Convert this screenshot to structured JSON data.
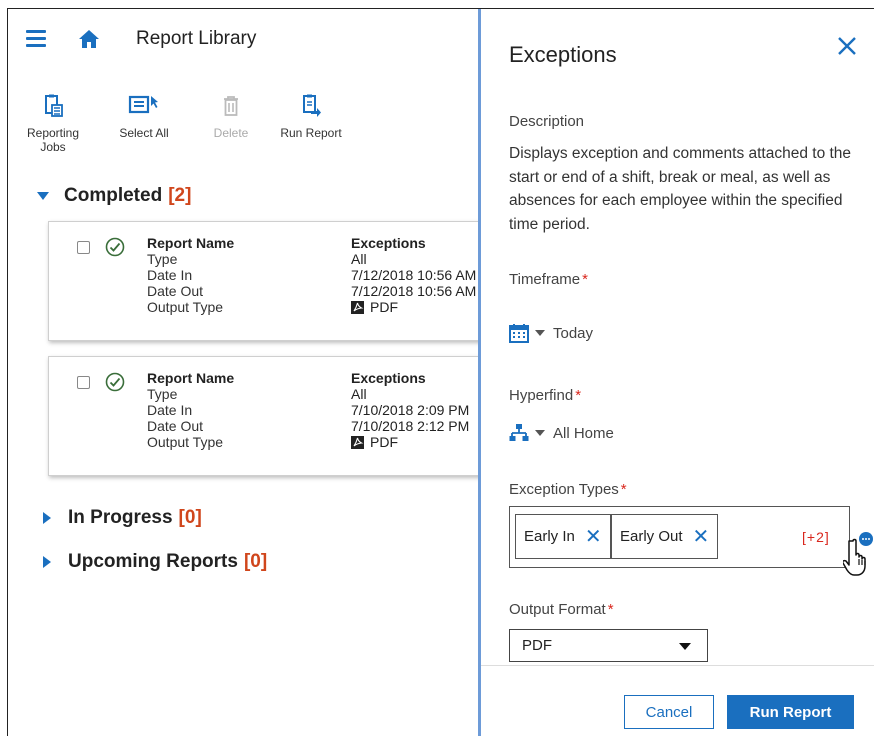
{
  "header": {
    "title": "Report Library"
  },
  "toolbar": {
    "items": [
      {
        "label": "Reporting\nJobs",
        "icon": "reporting-jobs-icon",
        "enabled": true
      },
      {
        "label": "Select All",
        "icon": "select-all-icon",
        "enabled": true
      },
      {
        "label": "Delete",
        "icon": "trash-icon",
        "enabled": false
      },
      {
        "label": "Run Report",
        "icon": "run-report-icon",
        "enabled": true
      }
    ]
  },
  "sections": {
    "completed": {
      "label": "Completed",
      "count": "[2]"
    },
    "in_progress": {
      "label": "In Progress",
      "count": "[0]"
    },
    "upcoming": {
      "label": "Upcoming Reports",
      "count": "[0]"
    }
  },
  "field_labels": {
    "report_name": "Report Name",
    "type": "Type",
    "date_in": "Date In",
    "date_out": "Date Out",
    "output_type": "Output Type"
  },
  "jobs": [
    {
      "report_name": "Exceptions",
      "type": "All",
      "date_in": "7/12/2018 10:56 AM",
      "date_out": "7/12/2018 10:56 AM",
      "output_type": "PDF"
    },
    {
      "report_name": "Exceptions",
      "type": "All",
      "date_in": "7/10/2018 2:09 PM",
      "date_out": "7/10/2018 2:12 PM",
      "output_type": "PDF"
    }
  ],
  "panel": {
    "title": "Exceptions",
    "description_label": "Description",
    "description": "Displays exception and comments attached to the start or end of a shift, break or meal, as well as absences for each employee within the specified time period.",
    "timeframe_label": "Timeframe",
    "timeframe_value": "Today",
    "hyperfind_label": "Hyperfind",
    "hyperfind_value": "All Home",
    "exception_types_label": "Exception Types",
    "exception_tags": [
      "Early In",
      "Early Out"
    ],
    "more_count": "[+2]",
    "output_format_label": "Output Format",
    "output_format_value": "PDF",
    "required_mark": "*",
    "cancel_label": "Cancel",
    "run_label": "Run Report"
  },
  "colors": {
    "accent": "#1a6fbf",
    "count": "#d0461c",
    "required": "#d9261c",
    "success": "#3a8a3a"
  }
}
